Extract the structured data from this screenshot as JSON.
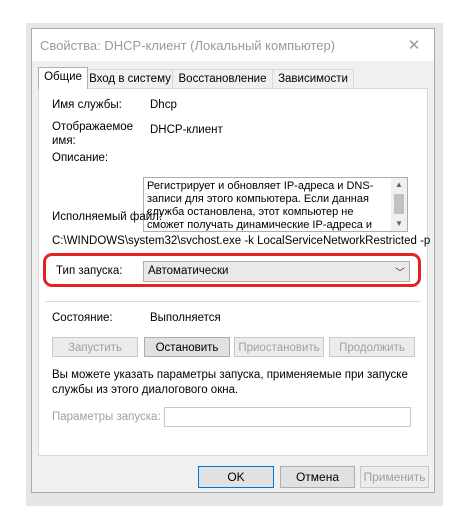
{
  "window": {
    "title": "Свойства: DHCP-клиент (Локальный компьютер)",
    "close_glyph": "✕"
  },
  "tabs": [
    {
      "label": "Общие",
      "active": true
    },
    {
      "label": "Вход в систему",
      "active": false
    },
    {
      "label": "Восстановление",
      "active": false
    },
    {
      "label": "Зависимости",
      "active": false
    }
  ],
  "general": {
    "service_name_label": "Имя службы:",
    "service_name": "Dhcp",
    "display_name_label": "Отображаемое\nимя:",
    "display_name": "DHCP-клиент",
    "description_label": "Описание:",
    "description": "Регистрирует и обновляет IP-адреса и DNS-записи для этого компьютера. Если данная служба остановлена, этот компьютер не сможет получать динамические IP-адреса и",
    "exe_label": "Исполняемый файл:",
    "exe_path": "C:\\WINDOWS\\system32\\svchost.exe -k LocalServiceNetworkRestricted -p",
    "startup_type_label": "Тип запуска:",
    "startup_type": "Автоматически",
    "status_label": "Состояние:",
    "status": "Выполняется",
    "buttons": {
      "start": "Запустить",
      "stop": "Остановить",
      "pause": "Приостановить",
      "resume": "Продолжить"
    },
    "hint": "Вы можете указать параметры запуска, применяемые при запуске\nслужбы из этого диалогового окна.",
    "params_label": "Параметры запуска:",
    "params_value": ""
  },
  "footer": {
    "ok": "OK",
    "cancel": "Отмена",
    "apply": "Применить"
  },
  "colors": {
    "highlight": "#e32221",
    "default_button_border": "#0078d7"
  }
}
